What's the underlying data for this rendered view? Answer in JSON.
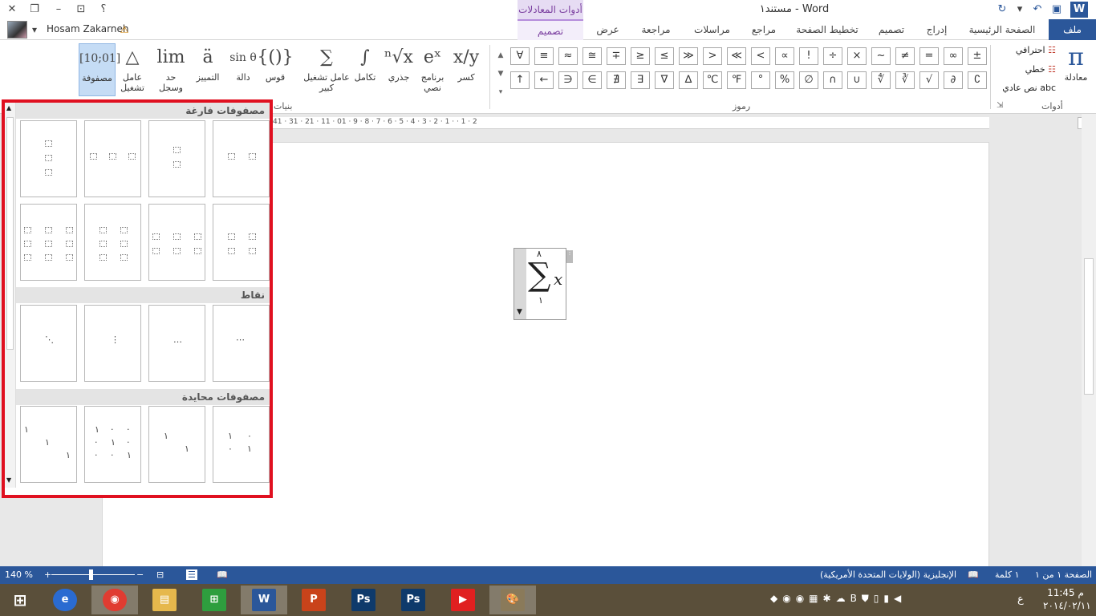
{
  "titlebar": {
    "doc_title": "مستند١ - Word",
    "context_group": "أدوات المعادلات",
    "help": "؟"
  },
  "user": {
    "name": "Hosam Zakarneh"
  },
  "tabs": {
    "file": "ملف",
    "home": "الصفحة الرئيسية",
    "insert": "إدراج",
    "design_doc": "تصميم",
    "layout": "تخطيط الصفحة",
    "references": "مراجع",
    "mailings": "مراسلات",
    "review": "مراجعة",
    "view": "عرض",
    "design_eq": "تصميم"
  },
  "ribbon": {
    "tools_group": {
      "label": "أدوات",
      "equation": "معادلة",
      "professional": "احترافي",
      "linear": "خطي",
      "normal_text": "نص عادي",
      "normal_text_prefix": "abc"
    },
    "symbols_group": {
      "label": "رموز",
      "row1": [
        "±",
        "∞",
        "=",
        "≠",
        "~",
        "×",
        "÷",
        "!",
        "∝",
        "<",
        "≪",
        ">",
        "≫",
        "≤",
        "≥",
        "∓",
        "≅",
        "≈",
        "≡",
        "∀"
      ],
      "row2": [
        "∁",
        "∂",
        "√",
        "∛",
        "∜",
        "∪",
        "∩",
        "∅",
        "%",
        "°",
        "℉",
        "℃",
        "∆",
        "∇",
        "∃",
        "∄",
        "∈",
        "∋",
        "←",
        "↑"
      ]
    },
    "structures_group": {
      "label": "بنيات",
      "buttons": [
        {
          "label": "كسر",
          "glyph": "x/y"
        },
        {
          "label": "برنامج نصي",
          "glyph": "eˣ"
        },
        {
          "label": "جذري",
          "glyph": "ⁿ√x"
        },
        {
          "label": "تكامل",
          "glyph": "∫"
        },
        {
          "label": "عامل تشغيل كبير",
          "glyph": "∑"
        },
        {
          "label": "قوس",
          "glyph": "{()}"
        },
        {
          "label": "دالة",
          "glyph": "sin θ"
        },
        {
          "label": "التمييز",
          "glyph": "ä"
        },
        {
          "label": "حد وسجل",
          "glyph": "lim"
        },
        {
          "label": "عامل تشغيل",
          "glyph": "△"
        },
        {
          "label": "مصفوفة",
          "glyph": "[10;01]"
        }
      ]
    }
  },
  "ruler": {
    "numbers": "41 · 31 · 21 · 11 · 01 · 9 · 8 · 7 · 6 · 5 · 4 · 3 · 2 · 1 · · 1 · 2"
  },
  "equation": {
    "upper": "٨",
    "lower": "١",
    "operator": "∑",
    "var": "x"
  },
  "gallery": {
    "sections": [
      "مصفوفات فارغة",
      "نقاط",
      "مصفوفات محايدة"
    ],
    "dots": [
      "⋯",
      "…",
      "⋮",
      "⋱"
    ]
  },
  "statusbar": {
    "page": "الصفحة ١ من ١",
    "words": "١ كلمة",
    "language": "الإنجليزية (الولايات المتحدة الأمريكية)",
    "zoom": "140 %"
  },
  "taskbar": {
    "apps": [
      "IE",
      "Chrome",
      "Explorer",
      "Store",
      "Word",
      "PowerPoint",
      "Ps",
      "Ps",
      "YouTube",
      "Paint"
    ],
    "time": "11:45 م",
    "date": "٢٠١٤/٠٢/١١",
    "lang": "ع"
  }
}
